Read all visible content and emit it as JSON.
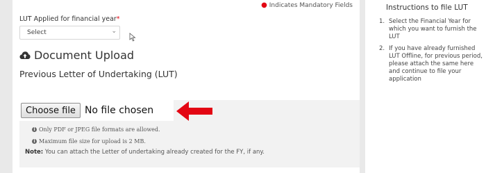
{
  "header": {
    "mandatory_note": "Indicates Mandatory Fields"
  },
  "form": {
    "lut_label": "LUT Applied for financial year",
    "select_value": "Select",
    "doc_upload_heading": "Document Upload",
    "prev_letter_label": "Previous Letter of Undertaking (LUT)",
    "choose_file_label": "Choose file",
    "no_file_text": "No file chosen",
    "info_formats": "Only PDF or JPEG file formats are allowed.",
    "info_size": "Maximum file size for upload is 2 MB.",
    "note_label": "Note:",
    "note_text": "You can attach the Letter of undertaking already created for the FY, if any."
  },
  "sidebar": {
    "title": "Instructions to file LUT",
    "items": [
      {
        "num": "1.",
        "text": "Select the Financial Year for which you want to furnish the LUT"
      },
      {
        "num": "2.",
        "text": "If you have already furnished LUT Offline, for previous period, please attach the same here and continue to file your application"
      }
    ]
  },
  "colors": {
    "required_star": "#e30613",
    "annotation_arrow": "#e30613",
    "page_background": "#e9e9e9",
    "upload_panel": "#f2f2f2"
  },
  "icons": {
    "upload": "cloud-upload-icon",
    "info": "info-circle-icon",
    "dropdown": "chevron-down-icon",
    "cursor": "mouse-cursor-icon",
    "annotation": "red-arrow-icon"
  }
}
